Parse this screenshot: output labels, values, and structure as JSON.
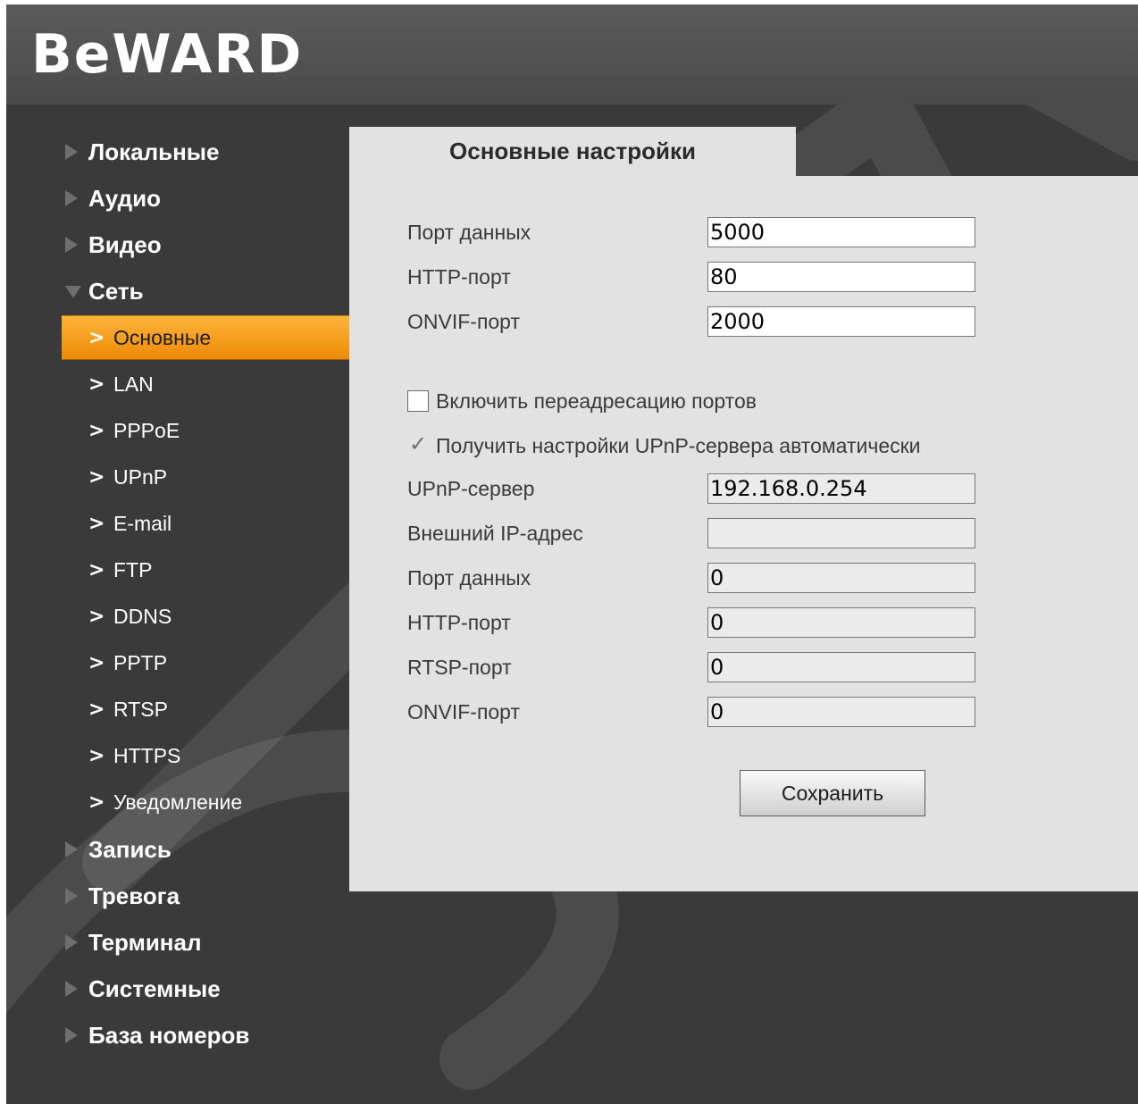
{
  "brand": {
    "logo": "BeWARD"
  },
  "sidebar": {
    "items": [
      {
        "label": "Локальные",
        "kind": "top"
      },
      {
        "label": "Аудио",
        "kind": "top"
      },
      {
        "label": "Видео",
        "kind": "top"
      },
      {
        "label": "Сеть",
        "kind": "top-expanded"
      },
      {
        "label": "Основные",
        "kind": "sub-active"
      },
      {
        "label": "LAN",
        "kind": "sub"
      },
      {
        "label": "PPPoE",
        "kind": "sub"
      },
      {
        "label": "UPnP",
        "kind": "sub"
      },
      {
        "label": "E-mail",
        "kind": "sub"
      },
      {
        "label": "FTP",
        "kind": "sub"
      },
      {
        "label": "DDNS",
        "kind": "sub"
      },
      {
        "label": "PPTP",
        "kind": "sub"
      },
      {
        "label": "RTSP",
        "kind": "sub"
      },
      {
        "label": "HTTPS",
        "kind": "sub"
      },
      {
        "label": "Уведомление",
        "kind": "sub"
      },
      {
        "label": "Запись",
        "kind": "top"
      },
      {
        "label": "Тревога",
        "kind": "top"
      },
      {
        "label": "Терминал",
        "kind": "top"
      },
      {
        "label": "Системные",
        "kind": "top"
      },
      {
        "label": "База номеров",
        "kind": "top"
      }
    ],
    "chevron": ">"
  },
  "main": {
    "tab_title": "Основные настройки",
    "ports": [
      {
        "label": "Порт данных",
        "value": "5000"
      },
      {
        "label": "HTTP-порт",
        "value": "80"
      },
      {
        "label": "ONVIF-порт",
        "value": "2000"
      }
    ],
    "port_forwarding": {
      "label": "Включить переадресацию портов",
      "checked": false
    },
    "upnp_auto": {
      "label": "Получить настройки UPnP-сервера автоматически",
      "checked": true,
      "disabled": true
    },
    "upnp_fields": [
      {
        "label": "UPnP-сервер",
        "value": "192.168.0.254"
      },
      {
        "label": "Внешний IP-адрес",
        "value": ""
      },
      {
        "label": "Порт данных",
        "value": "0"
      },
      {
        "label": "HTTP-порт",
        "value": "0"
      },
      {
        "label": "RTSP-порт",
        "value": "0"
      },
      {
        "label": "ONVIF-порт",
        "value": "0"
      }
    ],
    "save_label": "Сохранить"
  },
  "colors": {
    "background": "#3a3a3a",
    "header": "#4f4f4f",
    "panel": "#e2e2e2",
    "accent": "#f7a21c"
  }
}
